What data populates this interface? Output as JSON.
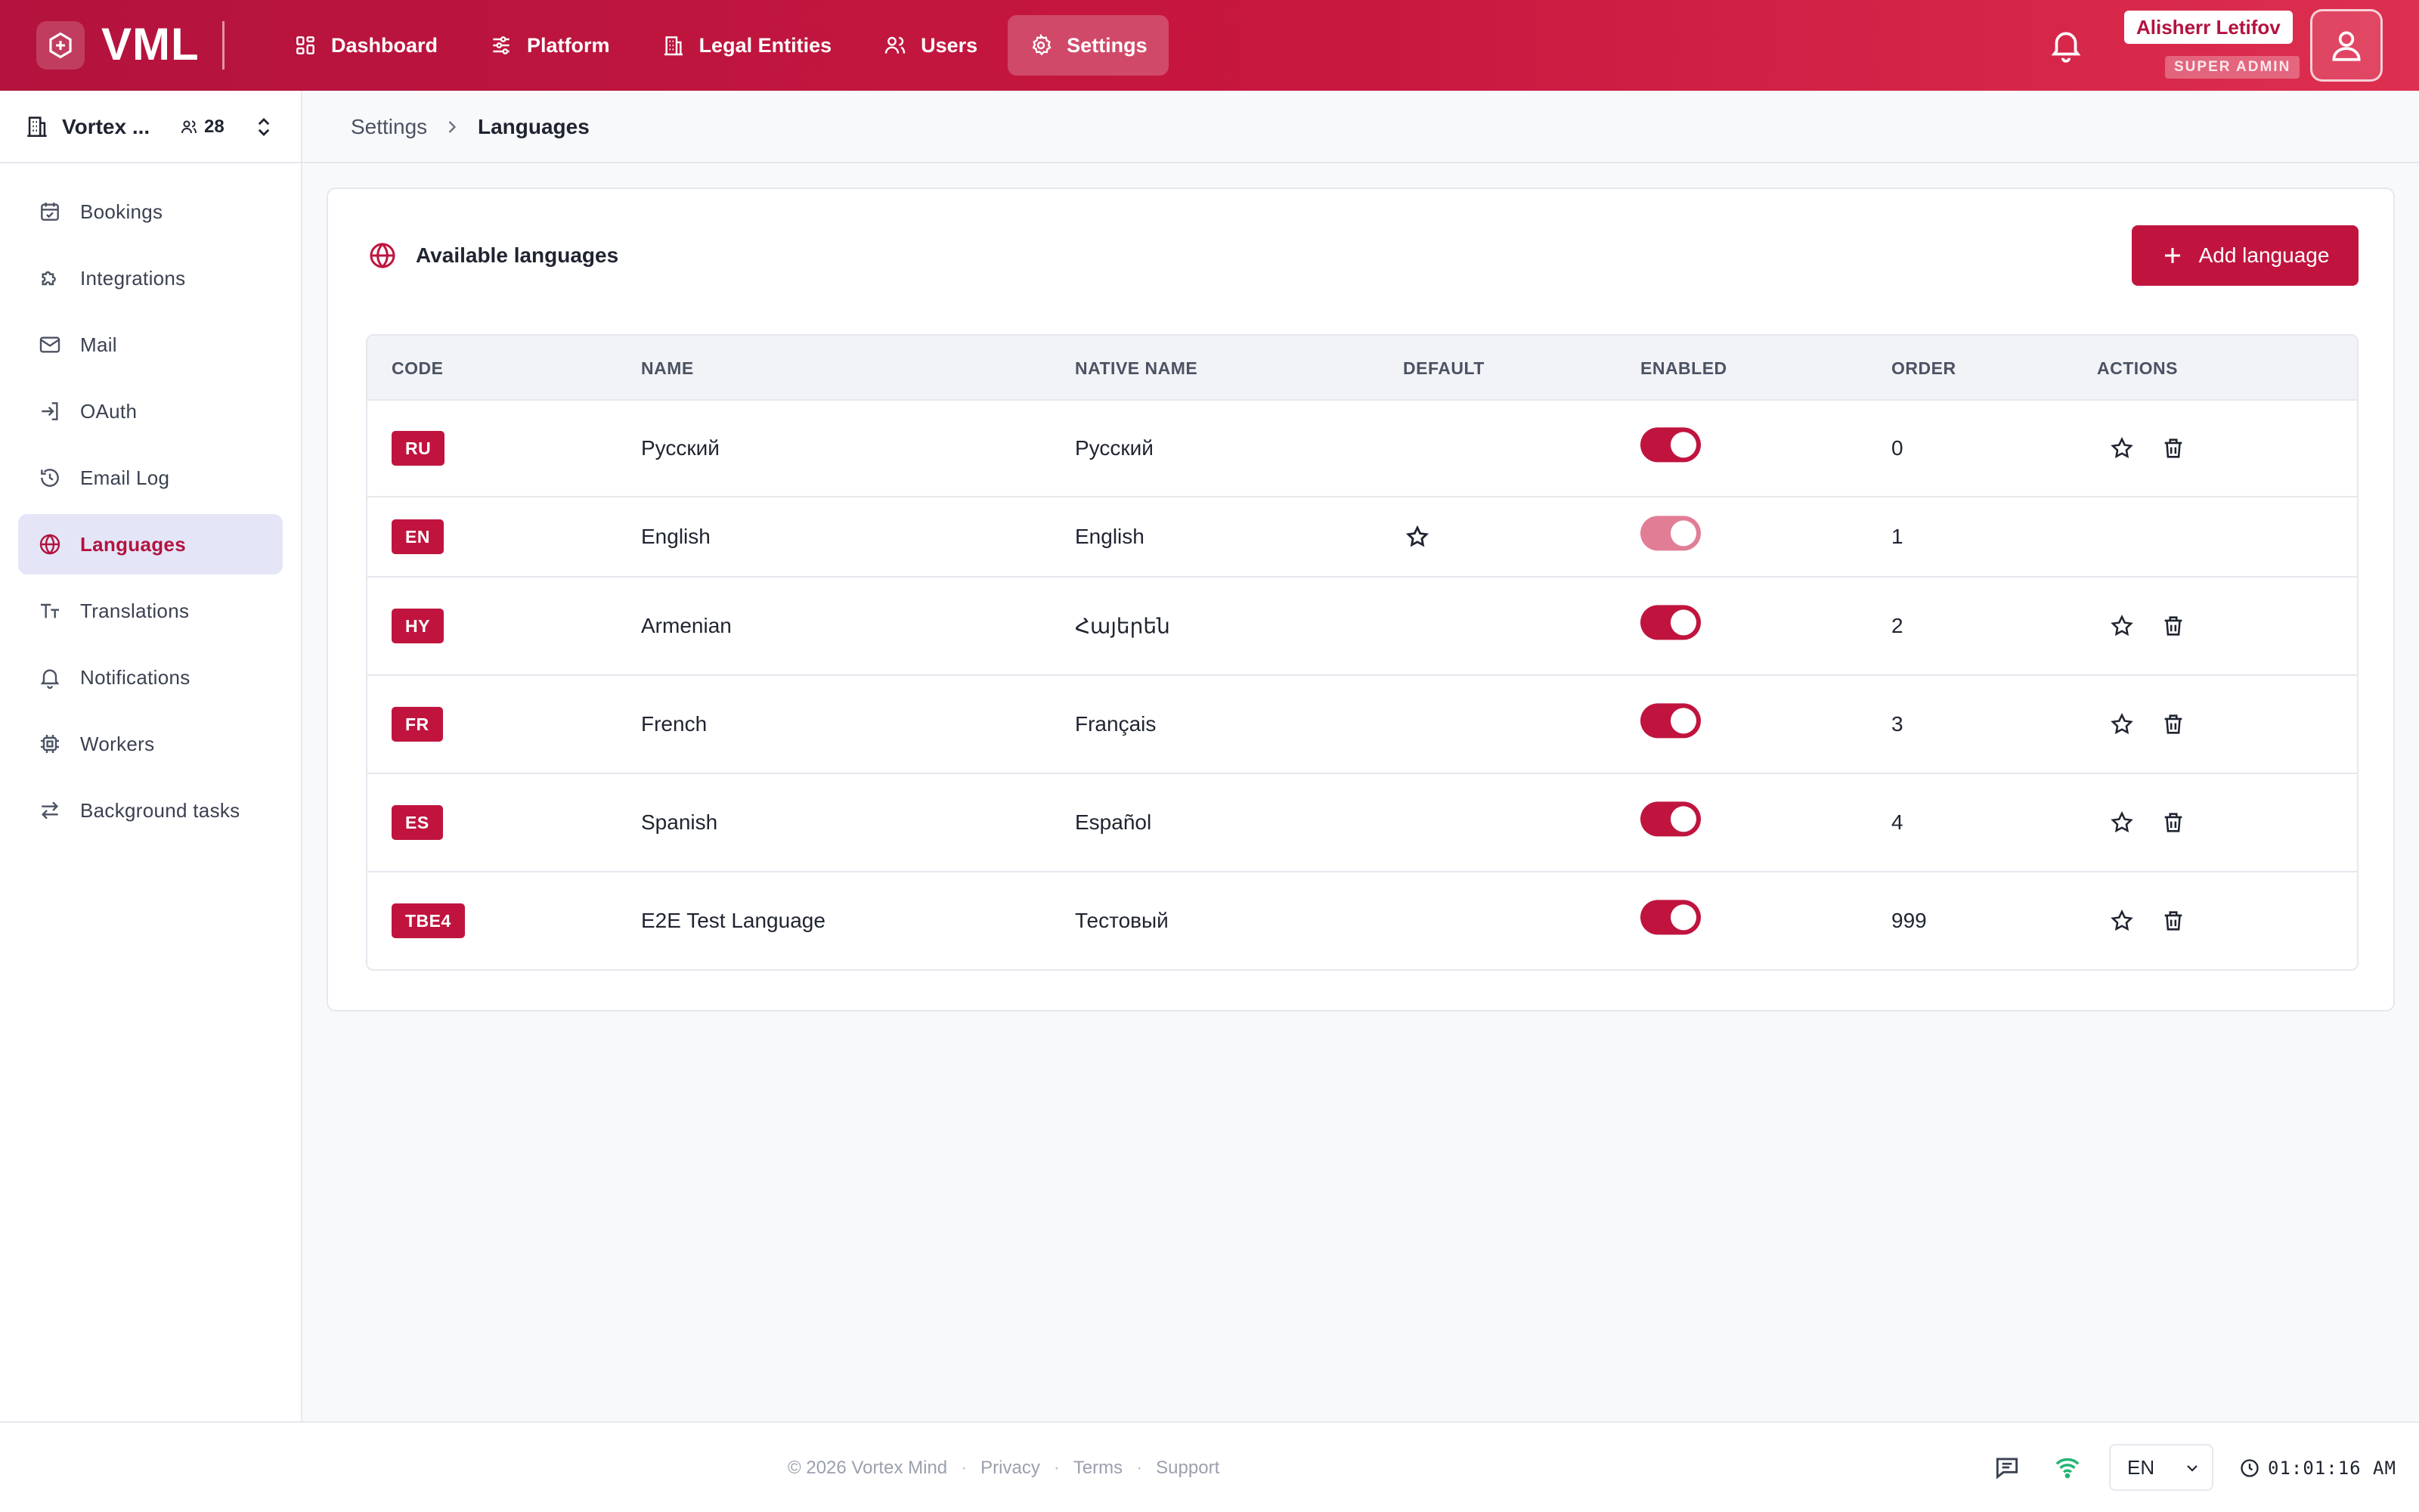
{
  "header": {
    "logo": "VML",
    "nav": [
      {
        "label": "Dashboard",
        "icon": "dashboard-icon"
      },
      {
        "label": "Platform",
        "icon": "sliders-icon"
      },
      {
        "label": "Legal Entities",
        "icon": "building-icon"
      },
      {
        "label": "Users",
        "icon": "users-icon"
      },
      {
        "label": "Settings",
        "icon": "gear-icon",
        "active": true
      }
    ],
    "user_name": "Alisherr Letifov",
    "user_role": "SUPER ADMIN"
  },
  "workspace": {
    "name": "Vortex ...",
    "members": "28"
  },
  "sidebar": {
    "items": [
      {
        "label": "Bookings",
        "icon": "calendar-icon"
      },
      {
        "label": "Integrations",
        "icon": "puzzle-icon"
      },
      {
        "label": "Mail",
        "icon": "mail-icon"
      },
      {
        "label": "OAuth",
        "icon": "login-icon"
      },
      {
        "label": "Email Log",
        "icon": "history-icon"
      },
      {
        "label": "Languages",
        "icon": "globe-icon",
        "active": true
      },
      {
        "label": "Translations",
        "icon": "text-size-icon"
      },
      {
        "label": "Notifications",
        "icon": "bell-icon"
      },
      {
        "label": "Workers",
        "icon": "cpu-icon"
      },
      {
        "label": "Background tasks",
        "icon": "arrows-icon"
      }
    ]
  },
  "breadcrumb": {
    "parent": "Settings",
    "current": "Languages"
  },
  "card": {
    "title": "Available languages",
    "add_button": "Add language"
  },
  "table": {
    "columns": [
      "CODE",
      "NAME",
      "NATIVE NAME",
      "DEFAULT",
      "ENABLED",
      "ORDER",
      "ACTIONS"
    ],
    "rows": [
      {
        "code": "RU",
        "name": "Русский",
        "native": "Русский",
        "is_default": false,
        "enabled": true,
        "order": "0"
      },
      {
        "code": "EN",
        "name": "English",
        "native": "English",
        "is_default": true,
        "enabled": true,
        "order": "1"
      },
      {
        "code": "HY",
        "name": "Armenian",
        "native": "Հայերեն",
        "is_default": false,
        "enabled": true,
        "order": "2"
      },
      {
        "code": "FR",
        "name": "French",
        "native": "Français",
        "is_default": false,
        "enabled": true,
        "order": "3"
      },
      {
        "code": "ES",
        "name": "Spanish",
        "native": "Español",
        "is_default": false,
        "enabled": true,
        "order": "4"
      },
      {
        "code": "TBE4",
        "name": "E2E Test Language",
        "native": "Тестовый",
        "is_default": false,
        "enabled": true,
        "order": "999"
      }
    ]
  },
  "footer": {
    "copyright": "© 2026 Vortex Mind",
    "links": [
      "Privacy",
      "Terms",
      "Support"
    ],
    "language": "EN",
    "time": "01:01:16 AM"
  },
  "colors": {
    "brand": "#c0143f",
    "brand_gradient_end": "#dd2f4f",
    "active_bg": "#e4e6f8",
    "online": "#22b573"
  }
}
